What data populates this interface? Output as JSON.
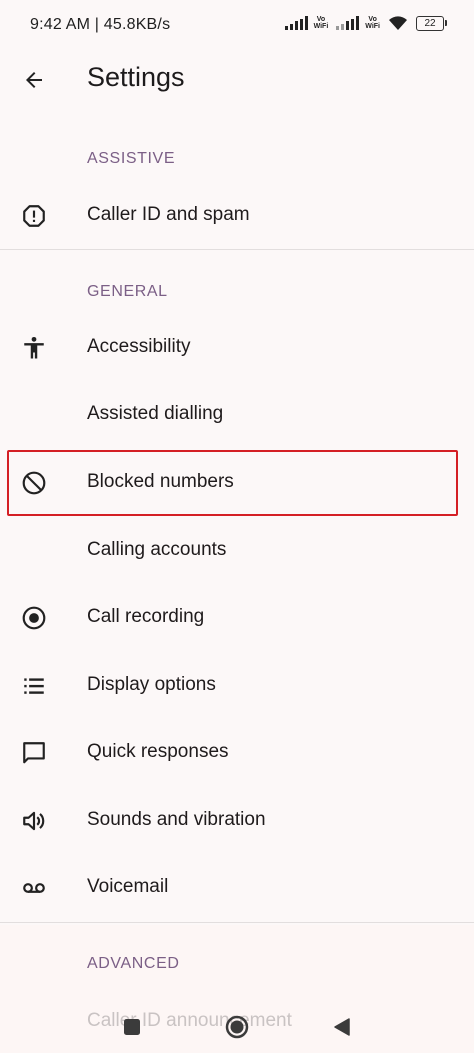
{
  "status_bar": {
    "time_and_speed": "9:42 AM | 45.8KB/s",
    "vowifi_line1": "Vo",
    "vowifi_line2": "WiFi",
    "battery": "22"
  },
  "app_bar": {
    "title": "Settings"
  },
  "sections": {
    "assistive": {
      "header": "ASSISTIVE",
      "items": [
        {
          "label": "Caller ID and spam",
          "icon": "alert-octagon-icon"
        }
      ]
    },
    "general": {
      "header": "GENERAL",
      "items": [
        {
          "label": "Accessibility",
          "icon": "accessibility-icon"
        },
        {
          "label": "Assisted dialling",
          "icon": ""
        },
        {
          "label": "Blocked numbers",
          "icon": "block-icon"
        },
        {
          "label": "Calling accounts",
          "icon": ""
        },
        {
          "label": "Call recording",
          "icon": "record-icon"
        },
        {
          "label": "Display options",
          "icon": "list-icon"
        },
        {
          "label": "Quick responses",
          "icon": "chat-bubble-icon"
        },
        {
          "label": "Sounds and vibration",
          "icon": "speaker-icon"
        },
        {
          "label": "Voicemail",
          "icon": "voicemail-icon"
        }
      ]
    },
    "advanced": {
      "header": "ADVANCED",
      "partial_item": "Caller ID announcement"
    }
  },
  "colors": {
    "section_header": "#7b5f86",
    "highlight_border": "#d41f25",
    "background": "#fcf8f8"
  }
}
